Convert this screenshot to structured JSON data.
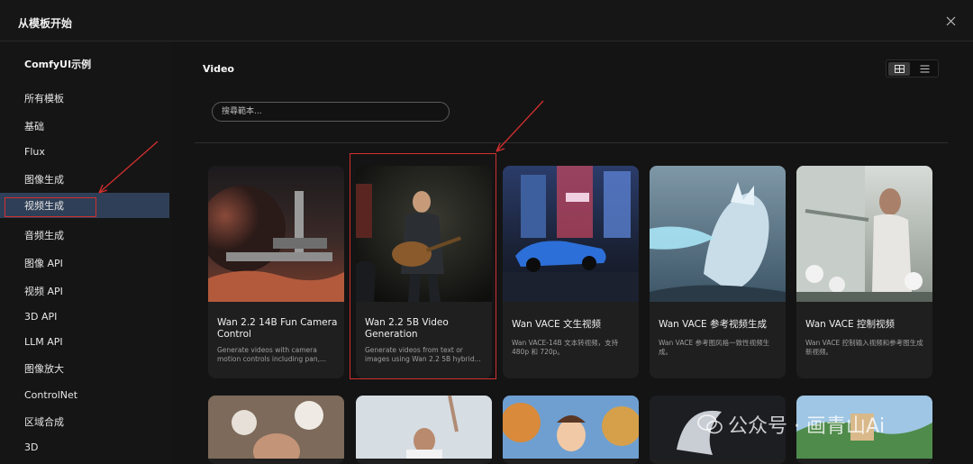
{
  "dialog": {
    "title": "从模板开始"
  },
  "sidebar": {
    "heading": "ComfyUI示例",
    "items": [
      {
        "label": "所有模板"
      },
      {
        "label": "基础"
      },
      {
        "label": "Flux"
      },
      {
        "label": "图像生成"
      },
      {
        "label": "视频生成"
      },
      {
        "label": "音频生成"
      },
      {
        "label": "图像 API"
      },
      {
        "label": "视频 API"
      },
      {
        "label": "3D API"
      },
      {
        "label": "LLM API"
      },
      {
        "label": "图像放大"
      },
      {
        "label": "ControlNet"
      },
      {
        "label": "区域合成"
      },
      {
        "label": "3D"
      }
    ],
    "active_item": "视频生成"
  },
  "main": {
    "section_title": "Video",
    "search": {
      "placeholder": "搜尋範本..."
    },
    "cards": [
      {
        "title": "Wan 2.2 14B Fun Camera Control",
        "description": "Generate videos with camera motion controls including pan,..."
      },
      {
        "title": "Wan 2.2 5B Video Generation",
        "description": "Generate videos from text or images using Wan 2.2 5B hybrid..."
      },
      {
        "title": "Wan VACE 文生视频",
        "description": "Wan VACE-14B 文本转视频，支持 480p 和 720p。"
      },
      {
        "title": "Wan VACE 参考视频生成",
        "description": "Wan VACE 参考图风格一致性视频生成。"
      },
      {
        "title": "Wan VACE 控制视频",
        "description": "Wan VACE 控制输入视频和参考图生成新视频。"
      }
    ]
  },
  "watermark": {
    "text": "公众号 · 画青山Ai"
  },
  "colors": {
    "active_item_bg": "#2f3f57",
    "annotation_red": "#d32f2f",
    "background": "#141414",
    "card_bg": "#1f1f1f"
  }
}
